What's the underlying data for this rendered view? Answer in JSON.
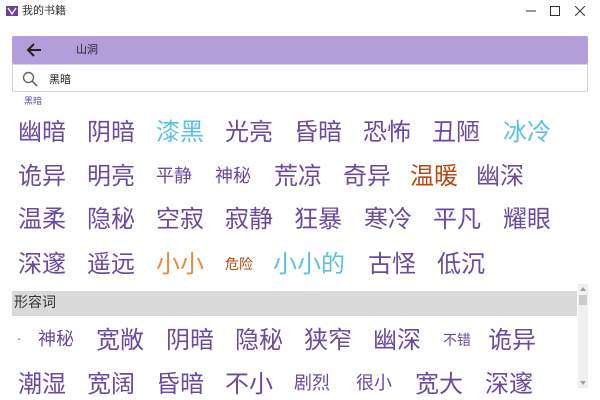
{
  "window": {
    "title": "我的书籍"
  },
  "header": {
    "title": "山洞"
  },
  "search": {
    "value": "黑暗",
    "placeholder": ""
  },
  "tag_label": "黑暗",
  "words_top": [
    {
      "text": "幽暗",
      "color": "purple"
    },
    {
      "text": "阴暗",
      "color": "purple"
    },
    {
      "text": "漆黑",
      "color": "blue"
    },
    {
      "text": "光亮",
      "color": "purple"
    },
    {
      "text": "昏暗",
      "color": "purple"
    },
    {
      "text": "恐怖",
      "color": "purple"
    },
    {
      "text": "丑陋",
      "color": "purple"
    },
    {
      "text": "冰冷",
      "color": "blue"
    },
    {
      "text": "诡异",
      "color": "purple"
    },
    {
      "text": "明亮",
      "color": "purple"
    },
    {
      "text": "平静",
      "color": "purple"
    },
    {
      "text": "神秘",
      "color": "purple"
    },
    {
      "text": "荒凉",
      "color": "purple"
    },
    {
      "text": "奇异",
      "color": "purple"
    },
    {
      "text": "温暖",
      "color": "brown"
    },
    {
      "text": "幽深",
      "color": "purple"
    },
    {
      "text": "温柔",
      "color": "purple"
    },
    {
      "text": "隐秘",
      "color": "purple"
    },
    {
      "text": "空寂",
      "color": "purple"
    },
    {
      "text": "寂静",
      "color": "purple"
    },
    {
      "text": "狂暴",
      "color": "purple"
    },
    {
      "text": "寒冷",
      "color": "purple"
    },
    {
      "text": "平凡",
      "color": "purple"
    },
    {
      "text": "耀眼",
      "color": "purple"
    },
    {
      "text": "深邃",
      "color": "purple"
    },
    {
      "text": "遥远",
      "color": "purple"
    },
    {
      "text": "小小",
      "color": "orange"
    },
    {
      "text": "危险",
      "color": "brown"
    },
    {
      "text": "小小的",
      "color": "blue"
    },
    {
      "text": "古怪",
      "color": "purple"
    },
    {
      "text": "低沉",
      "color": "purple"
    }
  ],
  "section": {
    "title": "形容词"
  },
  "words_bottom": [
    {
      "text": "神秘",
      "color": "purple"
    },
    {
      "text": "宽敞",
      "color": "purple"
    },
    {
      "text": "阴暗",
      "color": "purple"
    },
    {
      "text": "隐秘",
      "color": "purple"
    },
    {
      "text": "狭窄",
      "color": "purple"
    },
    {
      "text": "幽深",
      "color": "purple"
    },
    {
      "text": "不错",
      "color": "purple"
    },
    {
      "text": "诡异",
      "color": "purple"
    },
    {
      "text": "潮湿",
      "color": "purple"
    },
    {
      "text": "宽阔",
      "color": "purple"
    },
    {
      "text": "昏暗",
      "color": "purple"
    },
    {
      "text": "不小",
      "color": "purple"
    },
    {
      "text": "剧烈",
      "color": "purple"
    },
    {
      "text": "很小",
      "color": "purple"
    },
    {
      "text": "宽大",
      "color": "purple"
    },
    {
      "text": "深邃",
      "color": "purple"
    }
  ],
  "colors": {
    "header_bg": "#b39ddb",
    "purple": "#6a4aa0",
    "blue": "#5bbfe6",
    "orange": "#e8893a",
    "brown": "#b34a11"
  },
  "icons": {
    "app": "book-icon",
    "back": "arrow-left-icon",
    "search": "search-icon"
  }
}
